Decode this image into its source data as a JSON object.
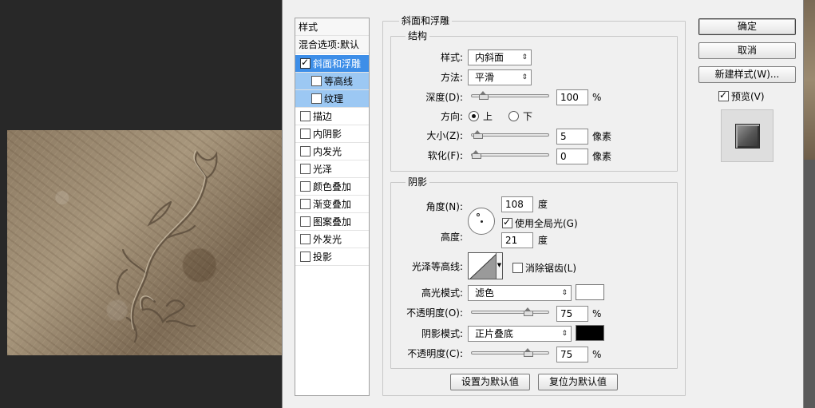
{
  "style_list": {
    "header": "样式",
    "blend_options": "混合选项:默认",
    "items": [
      {
        "label": "斜面和浮雕",
        "checked": true
      },
      {
        "label": "等高线",
        "checked": false
      },
      {
        "label": "纹理",
        "checked": false
      },
      {
        "label": "描边",
        "checked": false
      },
      {
        "label": "内阴影",
        "checked": false
      },
      {
        "label": "内发光",
        "checked": false
      },
      {
        "label": "光泽",
        "checked": false
      },
      {
        "label": "颜色叠加",
        "checked": false
      },
      {
        "label": "渐变叠加",
        "checked": false
      },
      {
        "label": "图案叠加",
        "checked": false
      },
      {
        "label": "外发光",
        "checked": false
      },
      {
        "label": "投影",
        "checked": false
      }
    ]
  },
  "bevel": {
    "title": "斜面和浮雕",
    "structure": {
      "title": "结构",
      "style_label": "样式:",
      "style_value": "内斜面",
      "technique_label": "方法:",
      "technique_value": "平滑",
      "depth_label": "深度(D):",
      "depth_value": "100",
      "depth_unit": "%",
      "depth_fraction": 0.1,
      "direction_label": "方向:",
      "direction_up": "上",
      "direction_down": "下",
      "size_label": "大小(Z):",
      "size_value": "5",
      "size_unit": "像素",
      "size_fraction": 0.02,
      "soften_label": "软化(F):",
      "soften_value": "0",
      "soften_unit": "像素",
      "soften_fraction": 0.0
    },
    "shading": {
      "title": "阴影",
      "angle_label": "角度(N):",
      "angle_value": "108",
      "angle_unit": "度",
      "global_light": "使用全局光(G)",
      "global_light_checked": true,
      "altitude_label": "高度:",
      "altitude_value": "21",
      "altitude_unit": "度",
      "gloss_label": "光泽等高线:",
      "anti_alias": "消除锯齿(L)",
      "anti_alias_checked": false,
      "highlight_mode_label": "高光模式:",
      "highlight_mode_value": "滤色",
      "highlight_color": "#ffffff",
      "highlight_opacity_label": "不透明度(O):",
      "highlight_opacity_value": "75",
      "highlight_opacity_unit": "%",
      "highlight_opacity_fraction": 0.75,
      "shadow_mode_label": "阴影模式:",
      "shadow_mode_value": "正片叠底",
      "shadow_color": "#000000",
      "shadow_opacity_label": "不透明度(C):",
      "shadow_opacity_value": "75",
      "shadow_opacity_unit": "%",
      "shadow_opacity_fraction": 0.75
    },
    "make_default": "设置为默认值",
    "reset_default": "复位为默认值"
  },
  "buttons": {
    "ok": "确定",
    "cancel": "取消",
    "new_style": "新建样式(W)...",
    "preview": "预览(V)",
    "preview_checked": true
  },
  "colors": {
    "selection": "#3d8ee8",
    "sub_selection": "#9cc8f3",
    "dialog_bg": "#f0f0f0"
  }
}
